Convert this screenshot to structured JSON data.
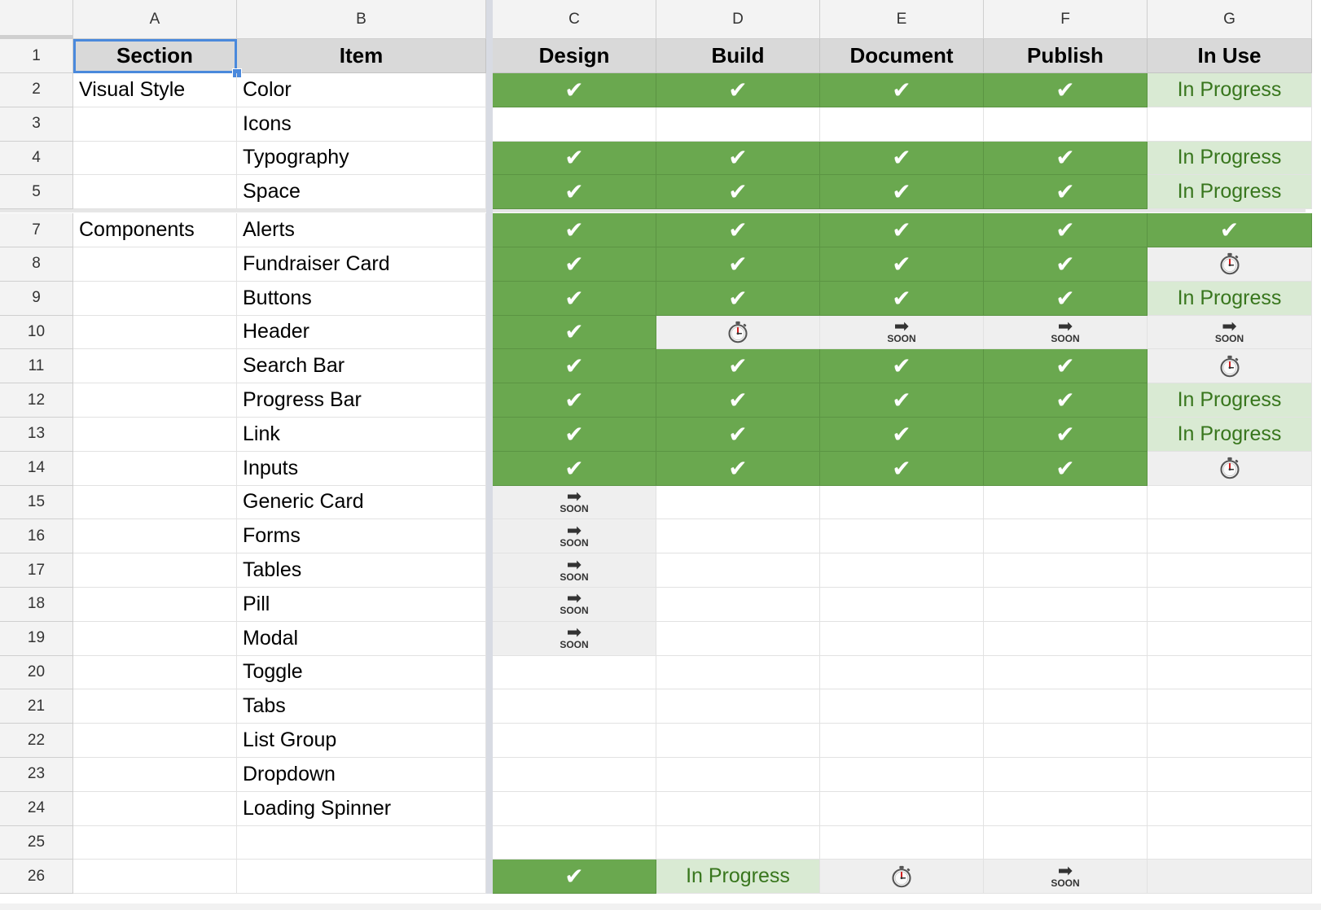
{
  "columns": [
    "A",
    "B",
    "C",
    "D",
    "E",
    "F",
    "G"
  ],
  "header": [
    "Section",
    "Item",
    "Design",
    "Build",
    "Document",
    "Publish",
    "In Use"
  ],
  "icons": {
    "done": "checkmark-icon",
    "waiting": "stopwatch-icon",
    "soon": "soon-arrow-icon"
  },
  "labels": {
    "check": "✔",
    "soon": "SOON",
    "arrow": "➡"
  },
  "colors": {
    "done": "#6aa84f",
    "in_progress_bg": "#d9ead3",
    "in_progress_text": "#38761d",
    "waiting_bg": "#efefef",
    "header_bg": "#d9d9d9",
    "selection": "#4a89dc"
  },
  "rows": [
    {
      "num": "2",
      "section": "Visual Style",
      "item": "Color",
      "status": [
        "done",
        "done",
        "done",
        "done",
        "In Progress"
      ]
    },
    {
      "num": "3",
      "section": "",
      "item": "Icons",
      "status": [
        "",
        "",
        "",
        "",
        ""
      ]
    },
    {
      "num": "4",
      "section": "",
      "item": "Typography",
      "status": [
        "done",
        "done",
        "done",
        "done",
        "In Progress"
      ]
    },
    {
      "num": "5",
      "section": "",
      "item": "Space",
      "status": [
        "done",
        "done",
        "done",
        "done",
        "In Progress"
      ]
    },
    {
      "num": "7",
      "section": "Components",
      "item": "Alerts",
      "status": [
        "done",
        "done",
        "done",
        "done",
        "done"
      ]
    },
    {
      "num": "8",
      "section": "",
      "item": "Fundraiser Card",
      "status": [
        "done",
        "done",
        "done",
        "done",
        "waiting"
      ]
    },
    {
      "num": "9",
      "section": "",
      "item": "Buttons",
      "status": [
        "done",
        "done",
        "done",
        "done",
        "In Progress"
      ]
    },
    {
      "num": "10",
      "section": "",
      "item": "Header",
      "status": [
        "done",
        "waiting",
        "soon",
        "soon",
        "soon"
      ]
    },
    {
      "num": "11",
      "section": "",
      "item": "Search Bar",
      "status": [
        "done",
        "done",
        "done",
        "done",
        "waiting"
      ]
    },
    {
      "num": "12",
      "section": "",
      "item": "Progress Bar",
      "status": [
        "done",
        "done",
        "done",
        "done",
        "In Progress"
      ]
    },
    {
      "num": "13",
      "section": "",
      "item": "Link",
      "status": [
        "done",
        "done",
        "done",
        "done",
        "In Progress"
      ]
    },
    {
      "num": "14",
      "section": "",
      "item": "Inputs",
      "status": [
        "done",
        "done",
        "done",
        "done",
        "waiting"
      ]
    },
    {
      "num": "15",
      "section": "",
      "item": "Generic Card",
      "status": [
        "soon",
        "",
        "",
        "",
        ""
      ]
    },
    {
      "num": "16",
      "section": "",
      "item": "Forms",
      "status": [
        "soon",
        "",
        "",
        "",
        ""
      ]
    },
    {
      "num": "17",
      "section": "",
      "item": "Tables",
      "status": [
        "soon",
        "",
        "",
        "",
        ""
      ]
    },
    {
      "num": "18",
      "section": "",
      "item": "Pill",
      "status": [
        "soon",
        "",
        "",
        "",
        ""
      ]
    },
    {
      "num": "19",
      "section": "",
      "item": "Modal",
      "status": [
        "soon",
        "",
        "",
        "",
        ""
      ]
    },
    {
      "num": "20",
      "section": "",
      "item": "Toggle",
      "status": [
        "",
        "",
        "",
        "",
        ""
      ]
    },
    {
      "num": "21",
      "section": "",
      "item": "Tabs",
      "status": [
        "",
        "",
        "",
        "",
        ""
      ]
    },
    {
      "num": "22",
      "section": "",
      "item": "List Group",
      "status": [
        "",
        "",
        "",
        "",
        ""
      ]
    },
    {
      "num": "23",
      "section": "",
      "item": "Dropdown",
      "status": [
        "",
        "",
        "",
        "",
        ""
      ]
    },
    {
      "num": "24",
      "section": "",
      "item": "Loading Spinner",
      "status": [
        "",
        "",
        "",
        "",
        ""
      ]
    },
    {
      "num": "25",
      "section": "",
      "item": "",
      "status": [
        "",
        "",
        "",
        "",
        ""
      ]
    },
    {
      "num": "26",
      "section": "",
      "item": "",
      "status": [
        "done",
        "In Progress",
        "waiting",
        "soon",
        "blank-grey"
      ]
    }
  ]
}
